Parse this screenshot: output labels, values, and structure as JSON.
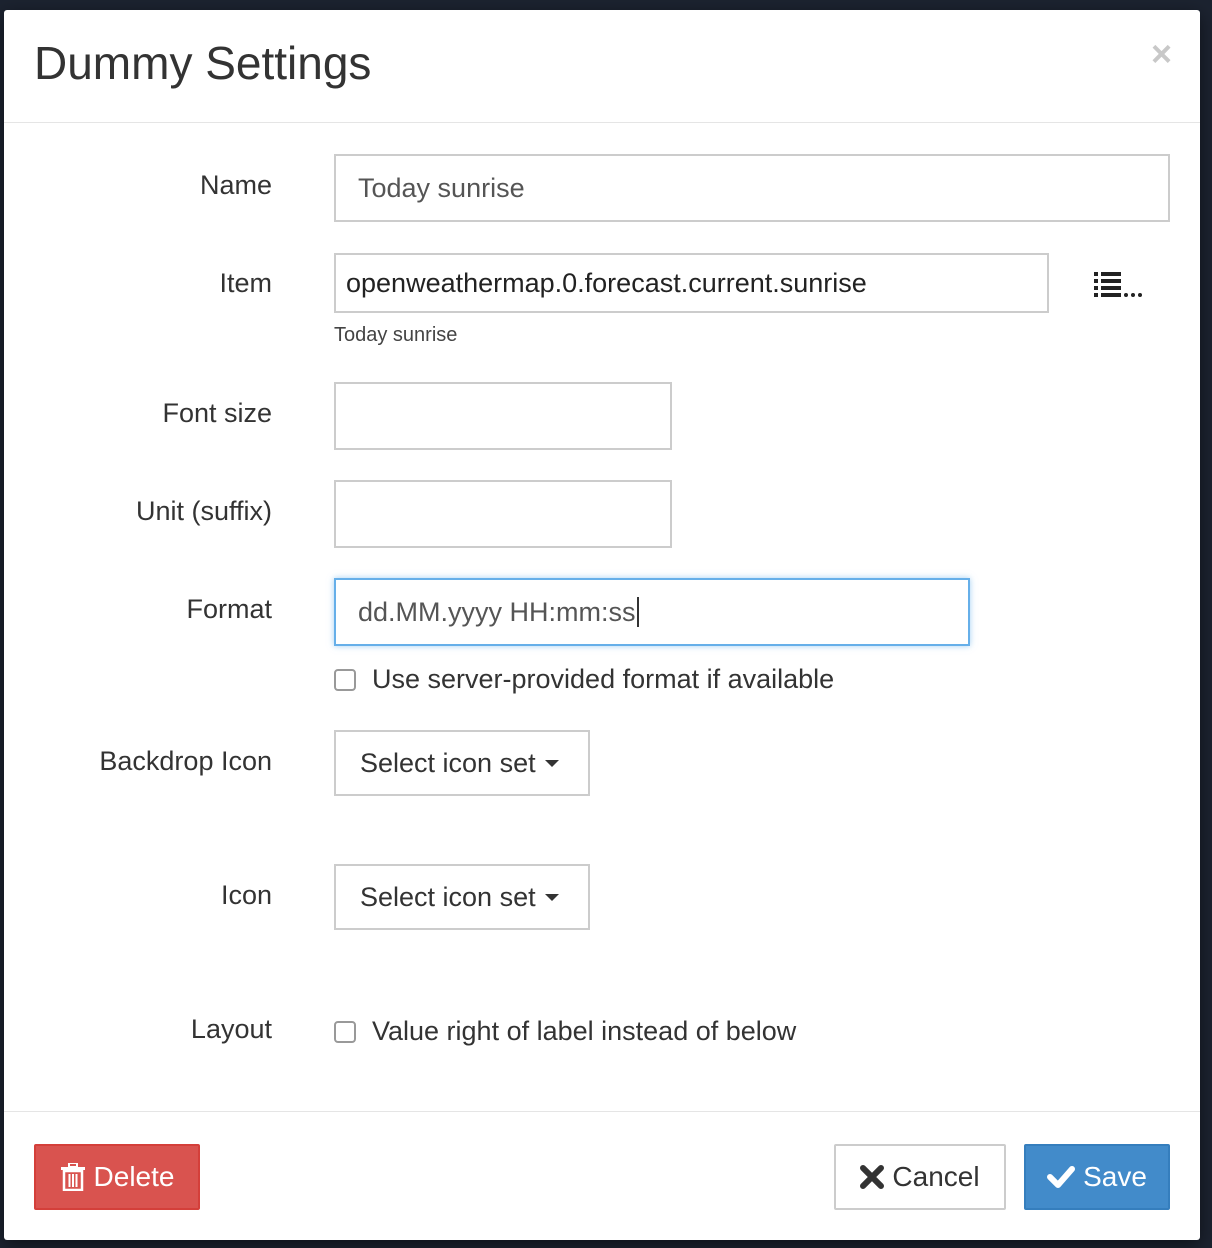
{
  "dialog": {
    "title": "Dummy Settings",
    "close_glyph": "×"
  },
  "fields": {
    "name": {
      "label": "Name",
      "value": "Today sunrise"
    },
    "item": {
      "label": "Item",
      "value": "openweathermap.0.forecast.current.sunrise",
      "help": "Today sunrise",
      "picker_icon": "list-icon"
    },
    "font_size": {
      "label": "Font size",
      "value": ""
    },
    "unit": {
      "label": "Unit (suffix)",
      "value": ""
    },
    "format": {
      "label": "Format",
      "value": "dd.MM.yyyy HH:mm:ss",
      "checkbox_label": "Use server-provided format if available",
      "checked": false
    },
    "backdrop_icon": {
      "label": "Backdrop Icon",
      "dropdown_label": "Select icon set"
    },
    "icon": {
      "label": "Icon",
      "dropdown_label": "Select icon set"
    },
    "layout": {
      "label": "Layout",
      "checkbox_label": "Value right of label instead of below",
      "checked": false
    }
  },
  "footer": {
    "delete_label": "Delete",
    "cancel_label": "Cancel",
    "save_label": "Save"
  },
  "colors": {
    "delete": "#d9534f",
    "save": "#428bca",
    "focus": "#66afe9",
    "backdrop": "#1c2330"
  }
}
